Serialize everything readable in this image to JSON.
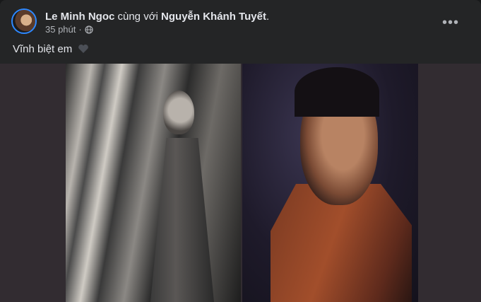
{
  "post": {
    "author": "Le Minh Ngoc",
    "with_text": "cùng với",
    "tagged": "Nguyễn Khánh Tuyết",
    "period": ".",
    "time": "35 phút",
    "separator": "·",
    "privacy_icon": "globe-icon",
    "text": "Vĩnh biệt em",
    "emoji_icon": "black-heart-icon",
    "more_icon": "more-options-icon",
    "more_label": "•••"
  },
  "photos": [
    {
      "name": "photo-1"
    },
    {
      "name": "photo-2"
    }
  ]
}
